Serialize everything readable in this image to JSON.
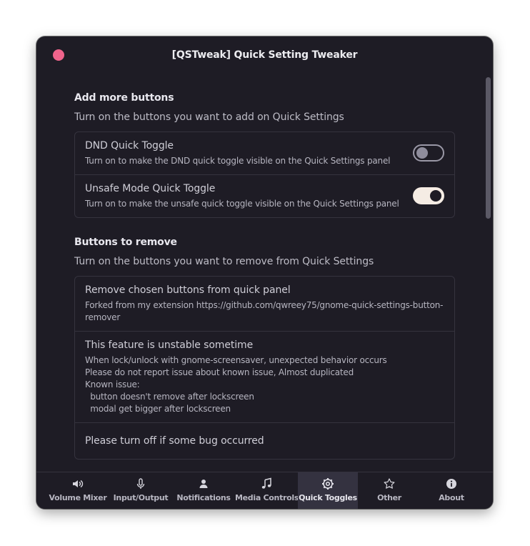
{
  "window": {
    "title": "[QSTweak] Quick Setting Tweaker"
  },
  "sections": {
    "add": {
      "title": "Add more buttons",
      "description": "Turn on the buttons you want to add on Quick Settings",
      "rows": [
        {
          "title": "DND Quick Toggle",
          "subtitle": "Turn on to make the DND quick toggle visible on the Quick Settings panel",
          "enabled": false
        },
        {
          "title": "Unsafe Mode Quick Toggle",
          "subtitle": "Turn on to make the unsafe quick toggle visible on the Quick Settings panel",
          "enabled": true
        }
      ]
    },
    "remove": {
      "title": "Buttons to remove",
      "description": "Turn on the buttons you want to remove from Quick Settings",
      "rows": [
        {
          "title": "Remove chosen buttons from quick panel",
          "subtitle_lines": [
            "Forked from my extension https://github.com/qwreey75/gnome-quick-settings-button-",
            "remover"
          ]
        },
        {
          "title": "This feature is unstable sometime",
          "subtitle_lines": [
            "When lock/unlock with gnome-screensaver, unexpected behavior occurs",
            "Please do not report issue about known issue, Almost duplicated",
            "Known issue:",
            "  button doesn't remove after lockscreen",
            "  modal get bigger after lockscreen"
          ]
        },
        {
          "title": "Please turn off if some bug occurred"
        }
      ]
    }
  },
  "tabs": [
    {
      "label": "Volume Mixer",
      "icon": "speaker-icon",
      "active": false
    },
    {
      "label": "Input/Output",
      "icon": "microphone-icon",
      "active": false
    },
    {
      "label": "Notifications",
      "icon": "person-icon",
      "active": false
    },
    {
      "label": "Media Controls",
      "icon": "music-note-icon",
      "active": false
    },
    {
      "label": "Quick Toggles",
      "icon": "gear-icon",
      "active": true
    },
    {
      "label": "Other",
      "icon": "star-icon",
      "active": false
    },
    {
      "label": "About",
      "icon": "info-icon",
      "active": false
    }
  ],
  "colors": {
    "close": "#f0648c",
    "background": "#1e1c25",
    "toggle_on": "#f5ece4",
    "active_tab": "#343240"
  }
}
